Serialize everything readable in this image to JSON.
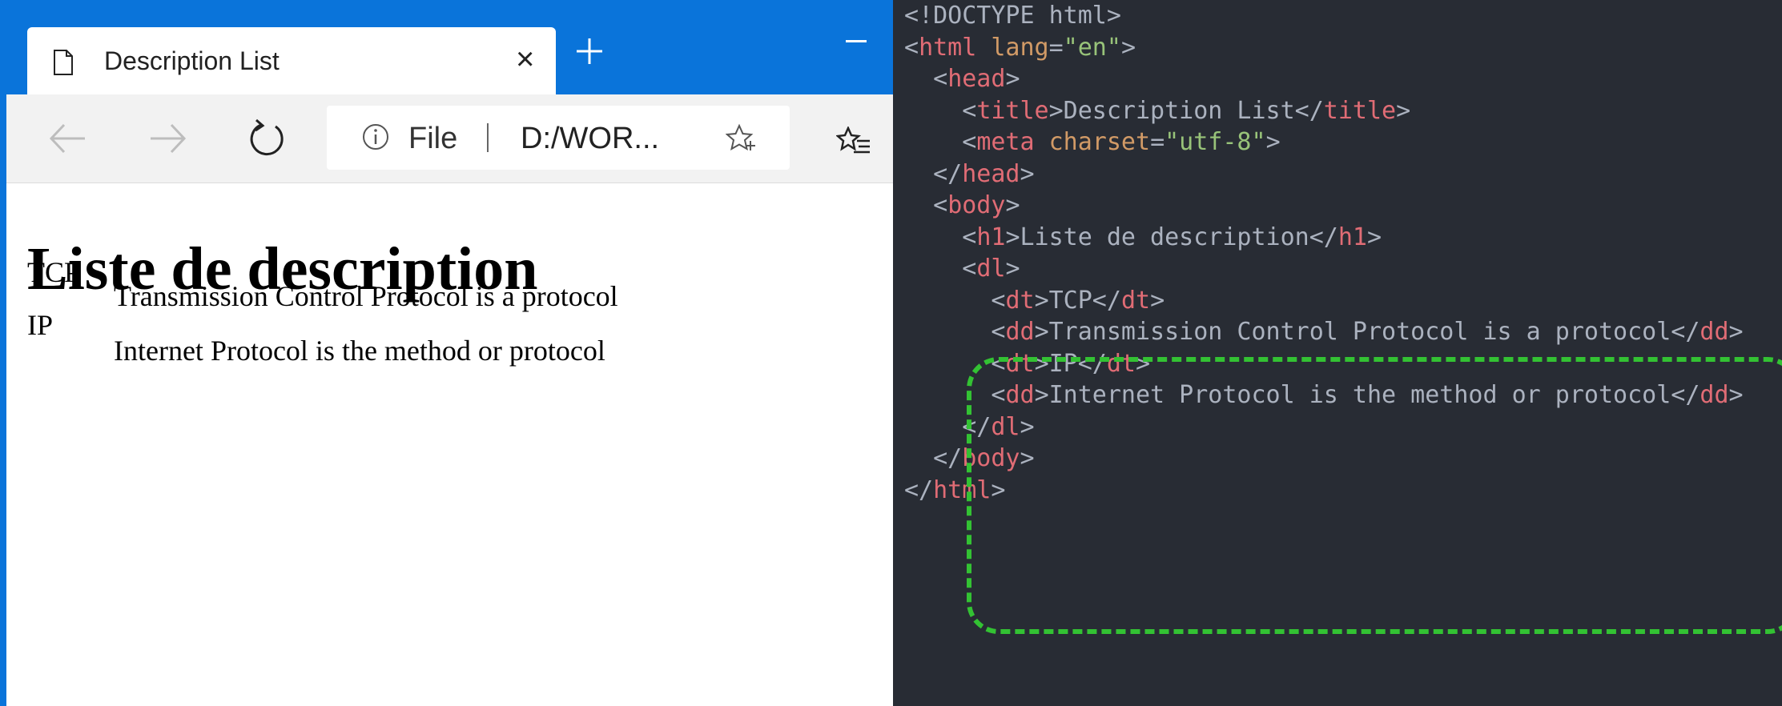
{
  "browser": {
    "tab_title": "Description List",
    "tab_close": "×",
    "address_prefix": "File",
    "address_url": "D:/WOR...",
    "icons": [
      "page-icon",
      "close-icon",
      "plus-icon",
      "minimize-icon",
      "back-arrow-icon",
      "forward-arrow-icon",
      "refresh-icon",
      "info-icon",
      "star-add-icon",
      "favorites-icon"
    ],
    "accent_color": "#0a74da"
  },
  "page": {
    "heading": "Liste de description",
    "dl": [
      {
        "term": "TCP",
        "desc": "Transmission Control Protocol is a protocol"
      },
      {
        "term": "IP",
        "desc": "Internet Protocol is the method or protocol"
      }
    ]
  },
  "editor": {
    "background": "#282c34",
    "highlight_color": "#33c233",
    "lines": [
      {
        "indent": "",
        "parts": [
          [
            "punc",
            "<!DOCTYPE html>"
          ]
        ]
      },
      {
        "indent": "",
        "parts": [
          [
            "punc",
            "<"
          ],
          [
            "tag",
            "html"
          ],
          [
            "punc",
            " "
          ],
          [
            "attr",
            "lang"
          ],
          [
            "punc",
            "="
          ],
          [
            "str",
            "\"en\""
          ],
          [
            "punc",
            ">"
          ]
        ]
      },
      {
        "indent": "  ",
        "parts": [
          [
            "punc",
            "<"
          ],
          [
            "tag",
            "head"
          ],
          [
            "punc",
            ">"
          ]
        ]
      },
      {
        "indent": "    ",
        "parts": [
          [
            "punc",
            "<"
          ],
          [
            "tag",
            "title"
          ],
          [
            "punc",
            ">Description List</"
          ],
          [
            "tag",
            "title"
          ],
          [
            "punc",
            ">"
          ]
        ]
      },
      {
        "indent": "    ",
        "parts": [
          [
            "punc",
            "<"
          ],
          [
            "tag",
            "meta"
          ],
          [
            "punc",
            " "
          ],
          [
            "attr",
            "charset"
          ],
          [
            "punc",
            "="
          ],
          [
            "str",
            "\"utf-8\""
          ],
          [
            "punc",
            ">"
          ]
        ]
      },
      {
        "indent": "  ",
        "parts": [
          [
            "punc",
            "</"
          ],
          [
            "tag",
            "head"
          ],
          [
            "punc",
            ">"
          ]
        ]
      },
      {
        "indent": "  ",
        "parts": [
          [
            "punc",
            "<"
          ],
          [
            "tag",
            "body"
          ],
          [
            "punc",
            ">"
          ]
        ]
      },
      {
        "indent": "    ",
        "parts": [
          [
            "punc",
            "<"
          ],
          [
            "tag",
            "h1"
          ],
          [
            "punc",
            ">Liste de description</"
          ],
          [
            "tag",
            "h1"
          ],
          [
            "punc",
            ">"
          ]
        ]
      },
      {
        "indent": "    ",
        "parts": [
          [
            "punc",
            "<"
          ],
          [
            "tag",
            "dl"
          ],
          [
            "punc",
            ">"
          ]
        ]
      },
      {
        "indent": "      ",
        "parts": [
          [
            "punc",
            "<"
          ],
          [
            "tag",
            "dt"
          ],
          [
            "punc",
            ">TCP</"
          ],
          [
            "tag",
            "dt"
          ],
          [
            "punc",
            ">"
          ]
        ]
      },
      {
        "indent": "      ",
        "parts": [
          [
            "punc",
            "<"
          ],
          [
            "tag",
            "dd"
          ],
          [
            "punc",
            ">Transmission Control Protocol is a protocol</"
          ],
          [
            "tag",
            "dd"
          ],
          [
            "punc",
            ">"
          ]
        ]
      },
      {
        "indent": "      ",
        "parts": [
          [
            "punc",
            "<"
          ],
          [
            "tag",
            "dt"
          ],
          [
            "punc",
            ">IP</"
          ],
          [
            "tag",
            "dt"
          ],
          [
            "punc",
            ">"
          ]
        ]
      },
      {
        "indent": "      ",
        "parts": [
          [
            "punc",
            "<"
          ],
          [
            "tag",
            "dd"
          ],
          [
            "punc",
            ">Internet Protocol is the method or protocol</"
          ],
          [
            "tag",
            "dd"
          ],
          [
            "punc",
            ">"
          ]
        ]
      },
      {
        "indent": "    ",
        "parts": [
          [
            "punc",
            "</"
          ],
          [
            "tag",
            "dl"
          ],
          [
            "punc",
            ">"
          ]
        ]
      },
      {
        "indent": "  ",
        "parts": [
          [
            "punc",
            "</"
          ],
          [
            "tag",
            "body"
          ],
          [
            "punc",
            ">"
          ]
        ]
      },
      {
        "indent": "",
        "parts": [
          [
            "punc",
            "</"
          ],
          [
            "tag",
            "html"
          ],
          [
            "punc",
            ">"
          ]
        ]
      }
    ]
  }
}
